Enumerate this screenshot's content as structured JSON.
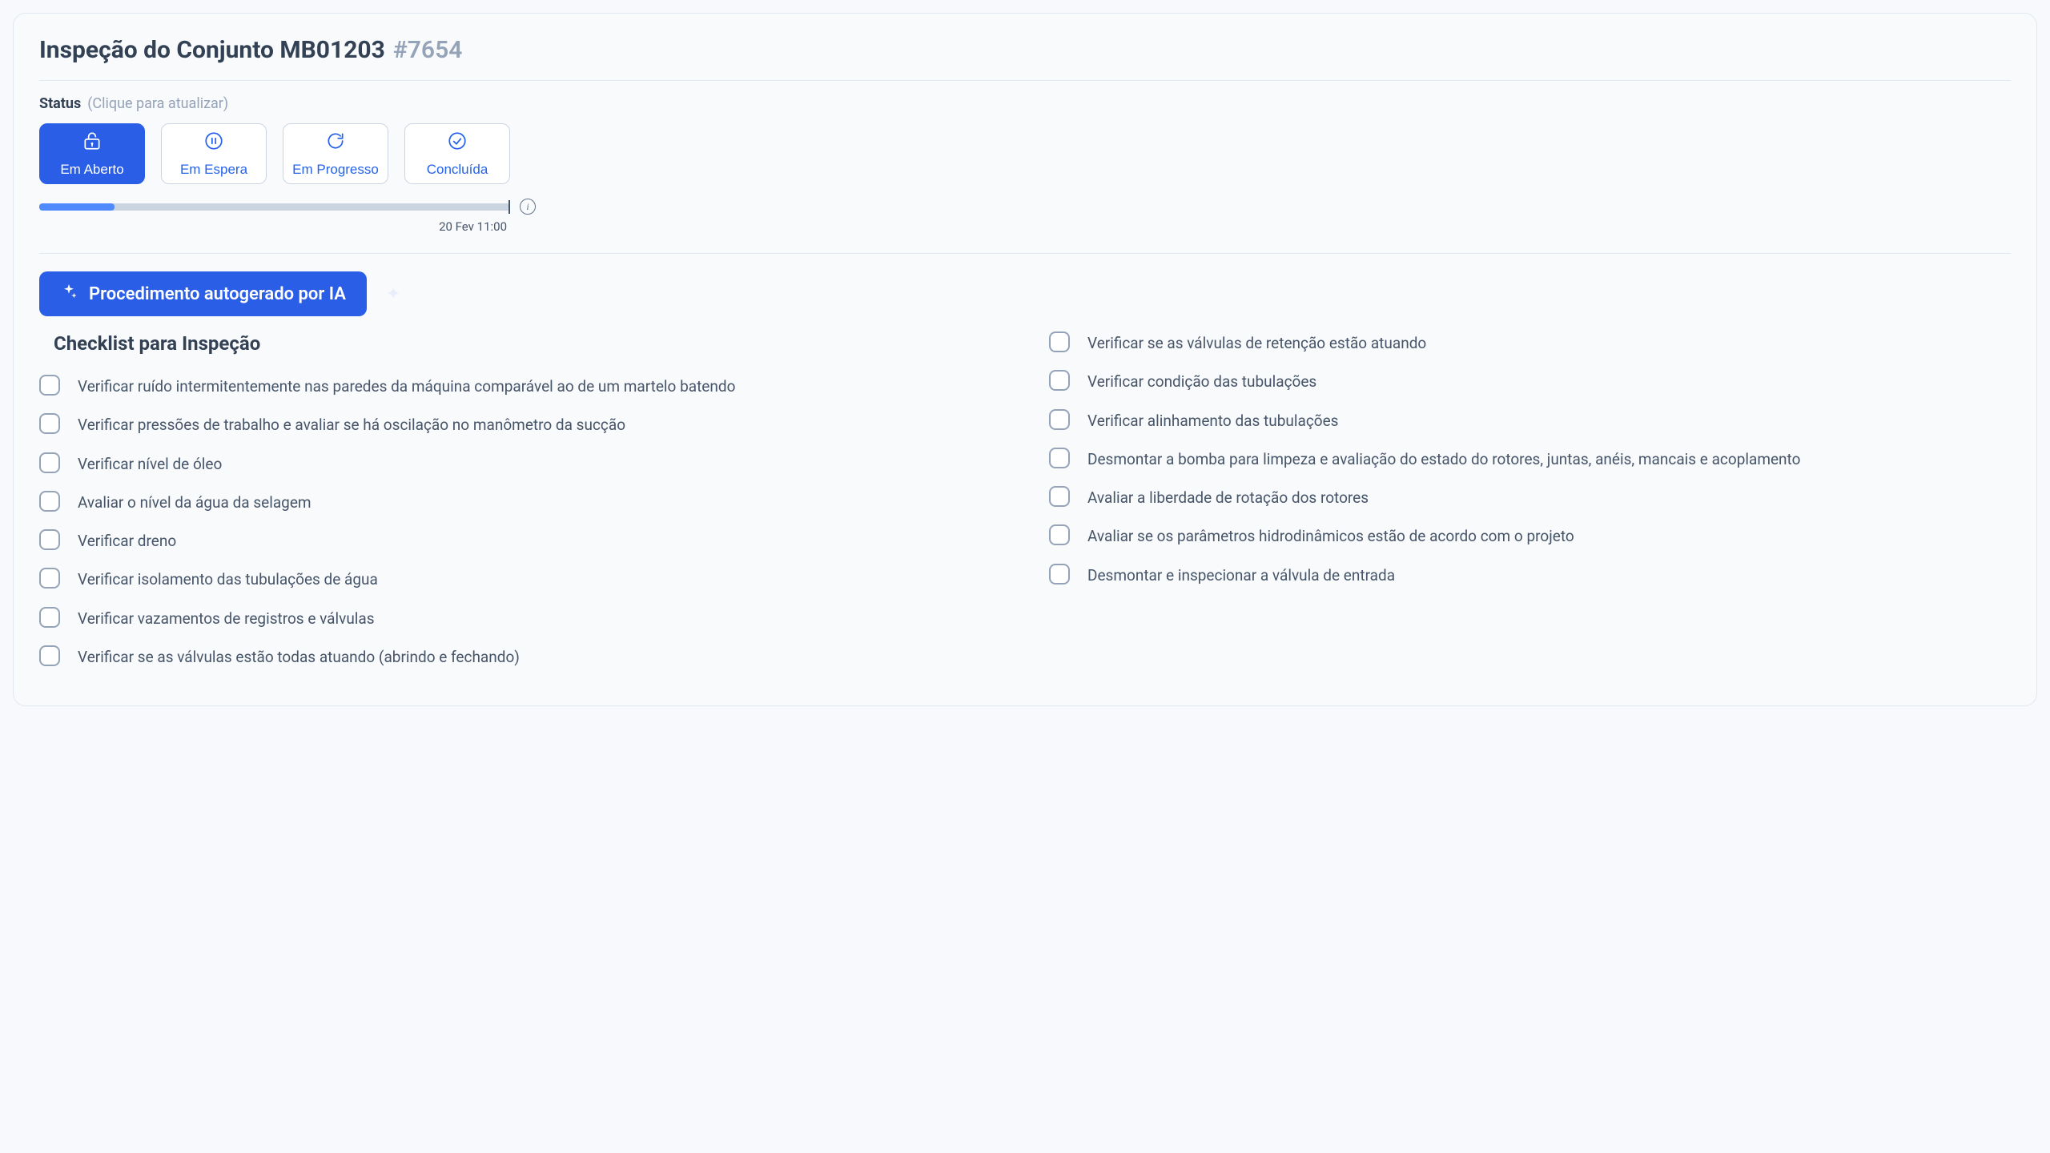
{
  "header": {
    "title": "Inspeção do Conjunto MB01203",
    "ticket_id": "#7654"
  },
  "status": {
    "label": "Status",
    "hint": "(Clique para atualizar)",
    "options": [
      {
        "key": "open",
        "label": "Em Aberto",
        "active": true
      },
      {
        "key": "hold",
        "label": "Em Espera",
        "active": false
      },
      {
        "key": "in_progress",
        "label": "Em Progresso",
        "active": false
      },
      {
        "key": "done",
        "label": "Concluída",
        "active": false
      }
    ],
    "progress_percent": 16,
    "due_label": "20 Fev 11:00"
  },
  "ai": {
    "badge_label": "Procedimento autogerado por IA"
  },
  "checklist": {
    "title": "Checklist para Inspeção",
    "left": [
      "Verificar ruído intermitentemente nas paredes da máquina comparável ao de um martelo batendo",
      "Verificar pressões de trabalho e avaliar se há oscilação no manômetro da sucção",
      "Verificar nível de óleo",
      "Avaliar o nível da água da selagem",
      "Verificar dreno",
      "Verificar isolamento das tubulações de água",
      "Verificar vazamentos de registros e válvulas",
      "Verificar se as válvulas estão todas atuando (abrindo e fechando)"
    ],
    "right": [
      "Verificar se as válvulas de retenção estão atuando",
      "Verificar condição das tubulações",
      "Verificar alinhamento das tubulações",
      "Desmontar a bomba para limpeza e avaliação do estado do rotores, juntas, anéis, mancais e acoplamento",
      "Avaliar a liberdade de rotação dos rotores",
      "Avaliar se os parâmetros hidrodinâmicos estão de acordo com o projeto",
      "Desmontar e inspecionar a válvula de entrada"
    ]
  }
}
